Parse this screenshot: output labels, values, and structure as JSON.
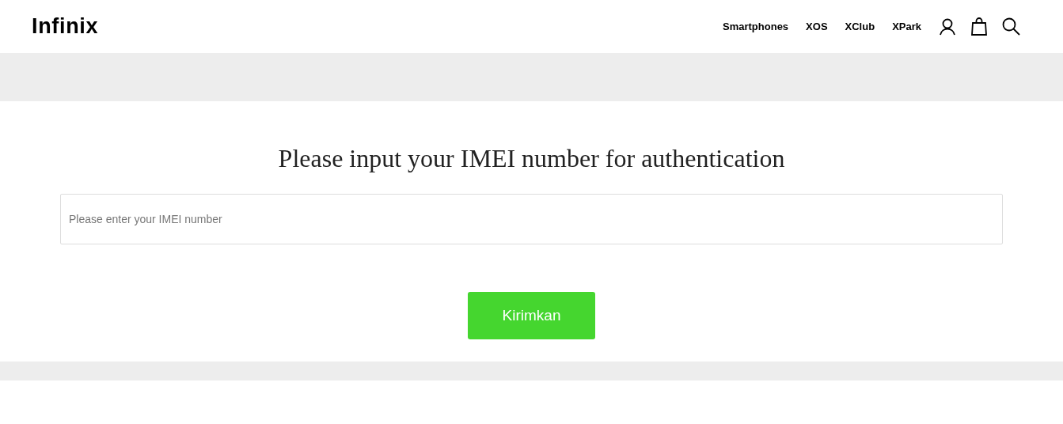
{
  "header": {
    "logo": "Infinix",
    "nav": [
      "Smartphones",
      "XOS",
      "XClub",
      "XPark"
    ]
  },
  "form": {
    "heading": "Please input your IMEI number for authentication",
    "imei_field": {
      "placeholder": "Please enter your IMEI number"
    },
    "submit_button": "Kirimkan"
  }
}
